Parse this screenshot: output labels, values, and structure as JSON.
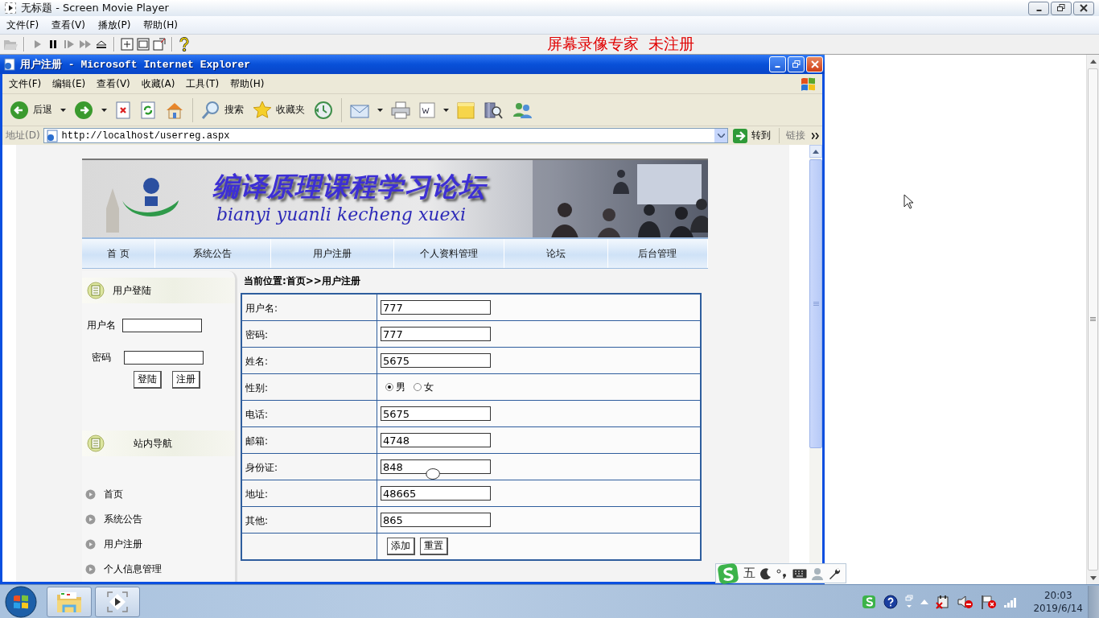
{
  "player": {
    "title": "无标题 - Screen Movie Player",
    "menu": [
      "文件(F)",
      "查看(V)",
      "播放(P)",
      "帮助(H)"
    ],
    "notice": "屏幕录像专家  未注册"
  },
  "browser": {
    "title": "用户注册 - Microsoft Internet Explorer",
    "menu": [
      "文件(F)",
      "编辑(E)",
      "查看(V)",
      "收藏(A)",
      "工具(T)",
      "帮助(H)"
    ],
    "toolbar": [
      {
        "kind": "back",
        "label": "后退",
        "dropdown": true
      },
      {
        "kind": "forward",
        "dropdown": true
      },
      {
        "kind": "stop",
        "dropdown": false
      },
      {
        "kind": "refresh",
        "dropdown": false
      },
      {
        "kind": "home",
        "dropdown": false
      },
      {
        "kind": "search",
        "label": "搜索",
        "dropdown": false
      },
      {
        "kind": "favorites",
        "label": "收藏夹",
        "dropdown": false
      },
      {
        "kind": "history",
        "dropdown": false
      },
      {
        "kind": "mail",
        "dropdown": true
      },
      {
        "kind": "print",
        "dropdown": false
      },
      {
        "kind": "edit",
        "dropdown": true
      },
      {
        "kind": "note",
        "dropdown": false
      },
      {
        "kind": "research",
        "dropdown": false
      },
      {
        "kind": "messenger",
        "dropdown": false
      }
    ],
    "address_label": "地址(D)",
    "address": "http://localhost/userreg.aspx",
    "go": "转到",
    "links": "链接"
  },
  "site": {
    "banner_title": "编译原理课程学习论坛",
    "banner_subtitle": "bianyi yuanli kecheng xuexi",
    "nav": [
      "首 页",
      "系统公告",
      "用户注册",
      "个人资料管理",
      "论坛",
      "后台管理"
    ],
    "login": {
      "title": "用户登陆",
      "fields": [
        {
          "label": "用户名"
        },
        {
          "label": "密码"
        }
      ],
      "buttons": [
        "登陆",
        "注册"
      ]
    },
    "site_nav": {
      "title": "站内导航",
      "items": [
        "首页",
        "系统公告",
        "用户注册",
        "个人信息管理"
      ]
    },
    "breadcrumb": "当前位置:首页>>用户注册",
    "form": {
      "rows": [
        {
          "kind": "text",
          "label": "用户名:",
          "value": "777"
        },
        {
          "kind": "text",
          "label": "密码:",
          "value": "777"
        },
        {
          "kind": "text",
          "label": "姓名:",
          "value": "5675"
        },
        {
          "kind": "radio",
          "label": "性别:",
          "options": [
            {
              "label": "男",
              "selected": true
            },
            {
              "label": "女",
              "selected": false
            }
          ]
        },
        {
          "kind": "text",
          "label": "电话:",
          "value": "5675"
        },
        {
          "kind": "text",
          "label": "邮箱:",
          "value": "4748"
        },
        {
          "kind": "text",
          "label": "身份证:",
          "value": "848"
        },
        {
          "kind": "text",
          "label": "地址:",
          "value": "48665"
        },
        {
          "kind": "text",
          "label": "其他:",
          "value": "865"
        }
      ],
      "buttons": [
        "添加",
        "重置"
      ]
    }
  },
  "ime": {
    "mode": "五"
  },
  "clock": {
    "time": "20:03",
    "date": "2019/6/14"
  }
}
